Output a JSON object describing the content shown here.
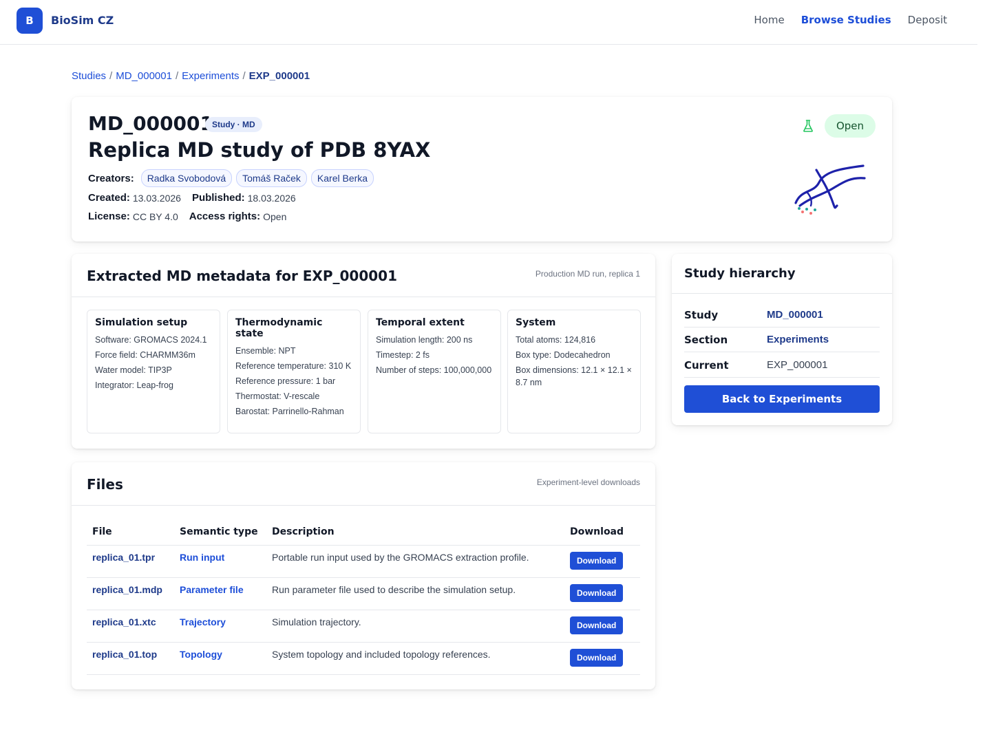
{
  "nav": {
    "logo_letter": "B",
    "brand": "BioSim CZ",
    "links": [
      "Home",
      "Browse Studies",
      "Deposit"
    ],
    "active": "Browse Studies"
  },
  "breadcrumb": {
    "items": [
      "Studies",
      "MD_000001",
      "Experiments"
    ],
    "separator": "/",
    "current": "EXP_000001"
  },
  "study": {
    "id": "MD_000001",
    "type_badge": "Study · MD",
    "title": "Replica MD study of PDB 8YAX",
    "creators_label": "Creators:",
    "creators": [
      "Radka Svobodová",
      "Tomáš Raček",
      "Karel Berka"
    ],
    "created_label": "Created:",
    "created": "13.03.2026",
    "published_label": "Published:",
    "published": "18.03.2026",
    "license_label": "License:",
    "license": "CC BY 4.0",
    "access_label": "Access rights:",
    "access": "Open",
    "status_badge": "Open",
    "status_color": "#dcfce7"
  },
  "metadata": {
    "title": "Extracted MD metadata for EXP_000001",
    "subtitle": "Production MD run, replica 1",
    "sections": [
      {
        "heading": "Simulation setup",
        "lines": [
          "Software: GROMACS 2024.1",
          "Force field: CHARMM36m",
          "Water model: TIP3P",
          "Integrator: Leap-frog"
        ]
      },
      {
        "heading": "Thermodynamic state",
        "lines": [
          "Ensemble: NPT",
          "Reference temperature: 310 K",
          "Reference pressure: 1 bar",
          "Thermostat: V-rescale",
          "Barostat: Parrinello-Rahman"
        ]
      },
      {
        "heading": "Temporal extent",
        "lines": [
          "Simulation length: 200 ns",
          "Timestep: 2 fs",
          "Number of steps: 100,000,000"
        ]
      },
      {
        "heading": "System",
        "lines": [
          "Total atoms: 124,816",
          "Box type: Dodecahedron",
          "Box dimensions: 12.1 × 12.1 × 8.7 nm"
        ]
      }
    ]
  },
  "files": {
    "title": "Files",
    "subtitle": "Experiment-level downloads",
    "columns": [
      "File",
      "Semantic type",
      "Description",
      "Download"
    ],
    "rows": [
      {
        "file": "replica_01.tpr",
        "type": "Run input",
        "description": "Portable run input used by the GROMACS extraction profile.",
        "action": "Download"
      },
      {
        "file": "replica_01.mdp",
        "type": "Parameter file",
        "description": "Run parameter file used to describe the simulation setup.",
        "action": "Download"
      },
      {
        "file": "replica_01.xtc",
        "type": "Trajectory",
        "description": "Simulation trajectory.",
        "action": "Download"
      },
      {
        "file": "replica_01.top",
        "type": "Topology",
        "description": "System topology and included topology references.",
        "action": "Download"
      }
    ]
  },
  "hierarchy": {
    "title": "Study hierarchy",
    "rows": [
      {
        "key": "Study",
        "value": "MD_000001"
      },
      {
        "key": "Section",
        "value": "Experiments"
      },
      {
        "key": "Current",
        "value": "EXP_000001"
      }
    ],
    "back_button": "Back to Experiments"
  },
  "colors": {
    "accent": "#1f4fd6",
    "brand_dark": "#1e3a8a",
    "open_badge_bg": "#dcfce7",
    "access_icon": "#22c55e"
  },
  "icons": {
    "access": "flask-icon",
    "molecule": "molecule-illustration-icon"
  }
}
